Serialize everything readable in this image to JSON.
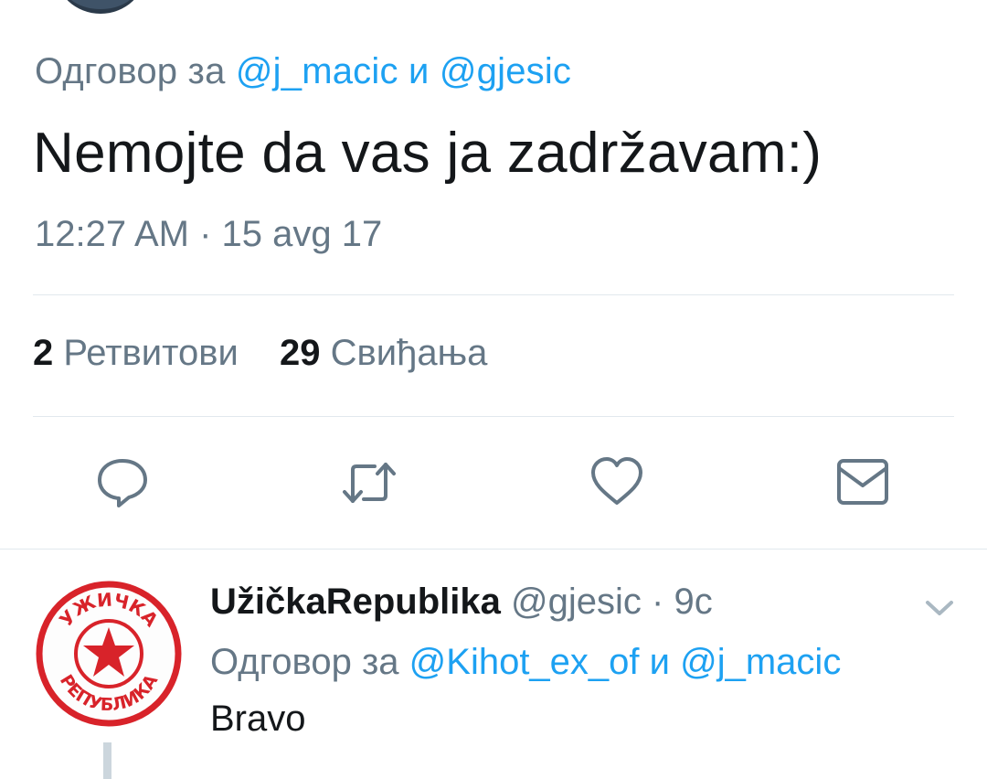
{
  "main_tweet": {
    "reply_prefix": "Одговор за",
    "reply_mention_1": "@j_macic",
    "reply_and": "и",
    "reply_mention_2": "@gjesic",
    "text": "Nemojte da vas ja zadržavam:)",
    "timestamp": "12:27 AM · 15 avg 17",
    "retweets_count": "2",
    "retweets_label": "Ретвитови",
    "likes_count": "29",
    "likes_label": "Свиђања"
  },
  "actions": {
    "reply_icon": "speech-bubble-icon",
    "retweet_icon": "retweet-icon",
    "like_icon": "heart-icon",
    "message_icon": "envelope-icon"
  },
  "reply_tweet": {
    "display_name": "UžičkaRepublika",
    "handle": "@gjesic",
    "time": "· 9c",
    "reply_prefix": "Одговор за",
    "reply_mention_1": "@Kihot_ex_of",
    "reply_and": "и",
    "reply_mention_2": "@j_macic",
    "text": "Bravo",
    "avatar_text_top": "УЖИЧКА",
    "avatar_text_bottom": "РЕПУБЛИКА"
  },
  "colors": {
    "accent": "#1da1f2",
    "secondary_text": "#657786",
    "primary_text": "#14171a",
    "avatar_red": "#d8232a"
  }
}
